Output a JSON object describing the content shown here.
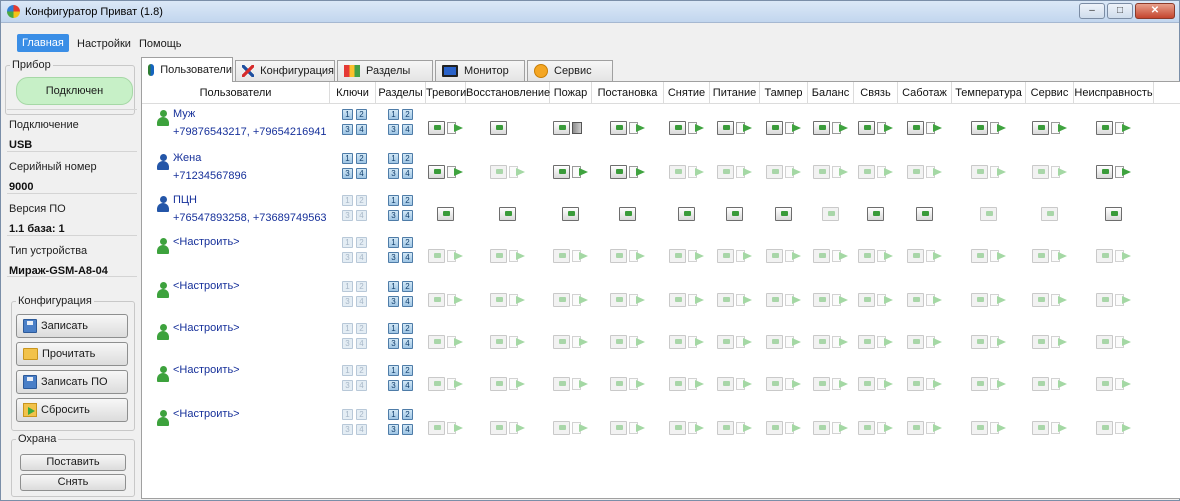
{
  "window": {
    "title": "Конфигуратор Приват (1.8)"
  },
  "menu": [
    "Главная",
    "Настройки",
    "Помощь"
  ],
  "device": {
    "group_title": "Прибор",
    "status": "Подключен",
    "fields": [
      {
        "label": "Подключение",
        "value": "USB"
      },
      {
        "label": "Серийный номер",
        "value": "9000"
      },
      {
        "label": "Версия ПО",
        "value": "1.1 база: 1"
      },
      {
        "label": "Тип устройства",
        "value": "Мираж-GSM-A8-04"
      }
    ]
  },
  "config": {
    "group_title": "Конфигурация",
    "buttons": [
      "Записать",
      "Прочитать",
      "Записать ПО",
      "Сбросить"
    ]
  },
  "guard": {
    "group_title": "Охрана",
    "buttons": [
      "Поставить",
      "Снять"
    ]
  },
  "tabs": [
    "Пользователи",
    "Конфигурация",
    "Разделы",
    "Монитор",
    "Сервис"
  ],
  "columns": [
    "Пользователи",
    "Ключи",
    "Разделы",
    "Тревоги",
    "Восстановление",
    "Пожар",
    "Постановка",
    "Снятие",
    "Питание",
    "Тампер",
    "Баланс",
    "Связь",
    "Саботаж",
    "Температура",
    "Сервис",
    "Неисправность"
  ],
  "users": [
    {
      "name": "Муж",
      "phones": "+79876543217, +79654216941",
      "icon_color": "green",
      "keys": [
        1,
        1,
        1,
        1
      ],
      "parts": [
        1,
        1,
        1,
        1
      ],
      "events": [
        "on",
        "no",
        "door",
        "on",
        "on",
        "on",
        "on",
        "on",
        "on",
        "on",
        "on",
        "on",
        "on"
      ]
    },
    {
      "name": "Жена",
      "phones": "+71234567896",
      "icon_color": "blue",
      "keys": [
        1,
        1,
        1,
        1
      ],
      "parts": [
        1,
        1,
        1,
        1
      ],
      "events": [
        "on",
        "dim",
        "on",
        "on",
        "dim",
        "dim",
        "dim",
        "dim",
        "dim",
        "dim",
        "dim",
        "dim",
        "on"
      ]
    },
    {
      "name": "ПЦН",
      "phones": "+76547893258, +73689749563",
      "icon_color": "blue",
      "keys": [
        0,
        0,
        0,
        0
      ],
      "parts": [
        1,
        1,
        1,
        1
      ],
      "events": [
        "only",
        "only",
        "only",
        "only",
        "only",
        "only",
        "only",
        "dimonly",
        "only",
        "only",
        "dimonly",
        "dimonly",
        "only"
      ]
    },
    {
      "name": "<Настроить>",
      "phones": "",
      "icon_color": "green",
      "keys": [
        0,
        0,
        0,
        0
      ],
      "parts": [
        1,
        1,
        1,
        1
      ],
      "events": [
        "dim",
        "dim",
        "dim",
        "dim",
        "dim",
        "dim",
        "dim",
        "dim",
        "dim",
        "dim",
        "dim",
        "dim",
        "dim"
      ]
    },
    {
      "name": "<Настроить>",
      "phones": "",
      "icon_color": "green",
      "keys": [
        0,
        0,
        0,
        0
      ],
      "parts": [
        1,
        1,
        1,
        1
      ],
      "events": [
        "dim",
        "dim",
        "dim",
        "dim",
        "dim",
        "dim",
        "dim",
        "dim",
        "dim",
        "dim",
        "dim",
        "dim",
        "dim"
      ]
    },
    {
      "name": "<Настроить>",
      "phones": "",
      "icon_color": "green",
      "keys": [
        0,
        0,
        0,
        0
      ],
      "parts": [
        1,
        1,
        1,
        1
      ],
      "events": [
        "dim",
        "dim",
        "dim",
        "dim",
        "dim",
        "dim",
        "dim",
        "dim",
        "dim",
        "dim",
        "dim",
        "dim",
        "dim"
      ]
    },
    {
      "name": "<Настроить>",
      "phones": "",
      "icon_color": "green",
      "keys": [
        0,
        0,
        0,
        0
      ],
      "parts": [
        1,
        1,
        1,
        1
      ],
      "events": [
        "dim",
        "dim",
        "dim",
        "dim",
        "dim",
        "dim",
        "dim",
        "dim",
        "dim",
        "dim",
        "dim",
        "dim",
        "dim"
      ]
    },
    {
      "name": "<Настроить>",
      "phones": "",
      "icon_color": "green",
      "keys": [
        0,
        0,
        0,
        0
      ],
      "parts": [
        1,
        1,
        1,
        1
      ],
      "events": [
        "dim",
        "dim",
        "dim",
        "dim",
        "dim",
        "dim",
        "dim",
        "dim",
        "dim",
        "dim",
        "dim",
        "dim",
        "dim"
      ]
    }
  ],
  "window_controls": [
    "–",
    "□",
    "✕"
  ]
}
